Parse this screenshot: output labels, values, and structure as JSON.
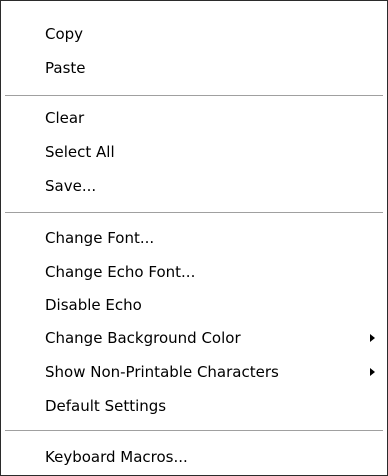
{
  "menu": {
    "items": [
      {
        "label": "Copy"
      },
      {
        "label": "Paste"
      },
      {
        "label": "Clear"
      },
      {
        "label": "Select All"
      },
      {
        "label": "Save..."
      },
      {
        "label": "Change Font..."
      },
      {
        "label": "Change Echo Font..."
      },
      {
        "label": "Disable Echo"
      },
      {
        "label": "Change Background Color",
        "submenu": true,
        "icon": "chevron-right-icon"
      },
      {
        "label": "Show Non-Printable Characters",
        "submenu": true,
        "icon": "chevron-right-icon"
      },
      {
        "label": "Default Settings"
      },
      {
        "label": "Keyboard Macros..."
      }
    ]
  }
}
